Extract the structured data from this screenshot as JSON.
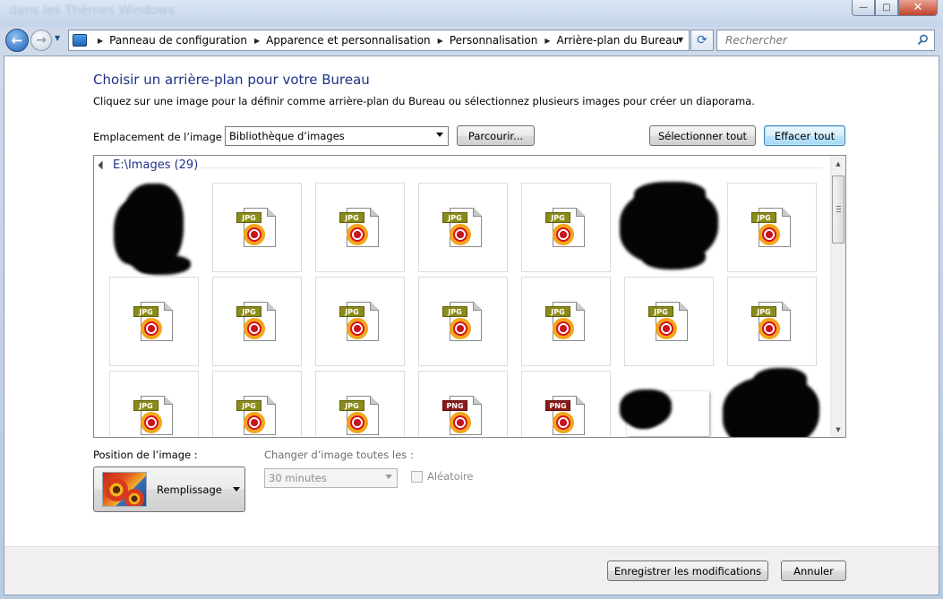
{
  "window": {
    "background_ghost_text": "dans les Thèmes Windows",
    "minimize_label": "—",
    "maximize_label": "□",
    "close_label": "✕"
  },
  "nav": {
    "back_glyph": "←",
    "forward_glyph": "→",
    "history_glyph": "▼",
    "breadcrumb": [
      "Panneau de configuration",
      "Apparence et personnalisation",
      "Personnalisation",
      "Arrière-plan du Bureau"
    ],
    "crumb_separator": "▶",
    "dropdown_glyph": "▼",
    "refresh_glyph": "⟳",
    "search_placeholder": "Rechercher"
  },
  "page": {
    "title": "Choisir un arrière-plan pour votre Bureau",
    "subtitle": "Cliquez sur une image pour la définir comme arrière-plan du Bureau ou sélectionnez plusieurs images pour créer un diaporama.",
    "location_label": "Emplacement de l’image :",
    "location_value": "Bibliothèque d’images",
    "browse_button": "Parcourir...",
    "select_all_button": "Sélectionner tout",
    "clear_all_button": "Effacer tout"
  },
  "gallery": {
    "group_title": "E:\\Images (29)",
    "scroll_up": "▲",
    "scroll_down": "▼",
    "tiles": [
      {
        "kind": "masked"
      },
      {
        "kind": "file",
        "ext": "JPG"
      },
      {
        "kind": "file",
        "ext": "JPG"
      },
      {
        "kind": "file",
        "ext": "JPG"
      },
      {
        "kind": "file",
        "ext": "JPG"
      },
      {
        "kind": "masked"
      },
      {
        "kind": "file",
        "ext": "JPG"
      },
      {
        "kind": "file",
        "ext": "JPG"
      },
      {
        "kind": "file",
        "ext": "JPG"
      },
      {
        "kind": "file",
        "ext": "JPG"
      },
      {
        "kind": "file",
        "ext": "JPG"
      },
      {
        "kind": "file",
        "ext": "JPG"
      },
      {
        "kind": "file",
        "ext": "JPG"
      },
      {
        "kind": "file",
        "ext": "JPG"
      },
      {
        "kind": "file",
        "ext": "JPG"
      },
      {
        "kind": "file",
        "ext": "JPG"
      },
      {
        "kind": "file",
        "ext": "JPG"
      },
      {
        "kind": "file",
        "ext": "PNG"
      },
      {
        "kind": "file",
        "ext": "PNG"
      },
      {
        "kind": "masked"
      },
      {
        "kind": "masked"
      }
    ]
  },
  "settings": {
    "position_label": "Position de l’image :",
    "position_value": "Remplissage",
    "change_label": "Changer d’image toutes les :",
    "interval_value": "30 minutes",
    "shuffle_label": "Aléatoire"
  },
  "footer": {
    "save_button": "Enregistrer les modifications",
    "cancel_button": "Annuler"
  },
  "colors": {
    "heading": "#1e3287",
    "focus_border": "#3c7fb1"
  }
}
